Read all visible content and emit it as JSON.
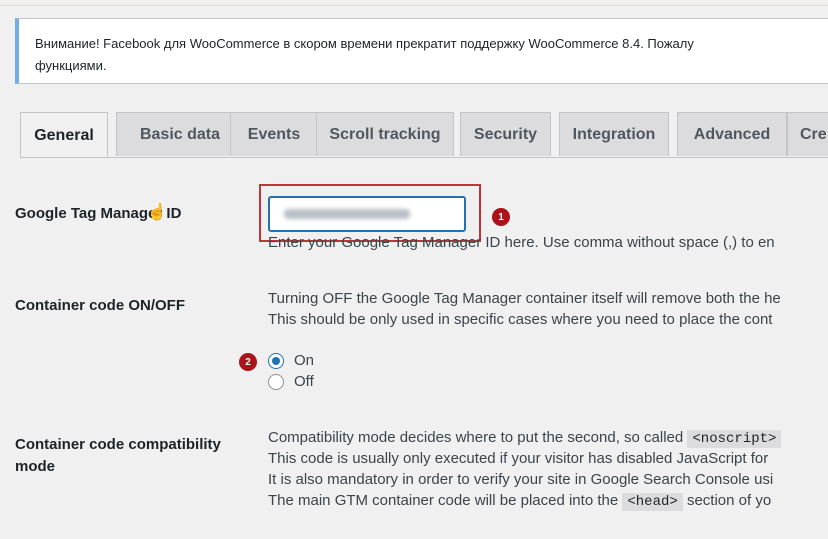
{
  "notice": {
    "line1": "Внимание! Facebook для WooCommerce в скором времени прекратит поддержку WooCommerce 8.4. Пожалу",
    "line2": "функциями."
  },
  "tabs": [
    {
      "label": "General",
      "active": true
    },
    {
      "label": "Basic data"
    },
    {
      "label": "Events"
    },
    {
      "label": "Scroll tracking"
    },
    {
      "label": "Security"
    },
    {
      "label": "Integration"
    },
    {
      "label": "Advanced"
    },
    {
      "label": "Cre"
    }
  ],
  "gtm_id": {
    "label": "Google Tag Manager ID",
    "value": "",
    "help": "Enter your Google Tag Manager ID here. Use comma without space (,) to en",
    "marker": "1"
  },
  "container_toggle": {
    "label": "Container code ON/OFF",
    "desc1": "Turning OFF the Google Tag Manager container itself will remove both the he",
    "desc2": "This should be only used in specific cases where you need to place the cont",
    "options": [
      {
        "label": "On",
        "checked": true
      },
      {
        "label": "Off",
        "checked": false
      }
    ],
    "marker": "2"
  },
  "compat_mode": {
    "label_line1": "Container code compatibility",
    "label_line2": "mode",
    "desc1_pre": "Compatibility mode decides where to put the second, so called ",
    "desc1_code": "<noscript>",
    "desc2": "This code is usually only executed if your visitor has disabled JavaScript for",
    "desc3": "It is also mandatory in order to verify your site in Google Search Console usi",
    "desc4_pre": "The main GTM container code will be placed into the ",
    "desc4_code": "<head>",
    "desc4_post": " section of yo"
  },
  "colors": {
    "accent": "#2271b1",
    "highlight": "#c0333a",
    "marker": "#a8141a",
    "notice_border": "#72aee6"
  }
}
